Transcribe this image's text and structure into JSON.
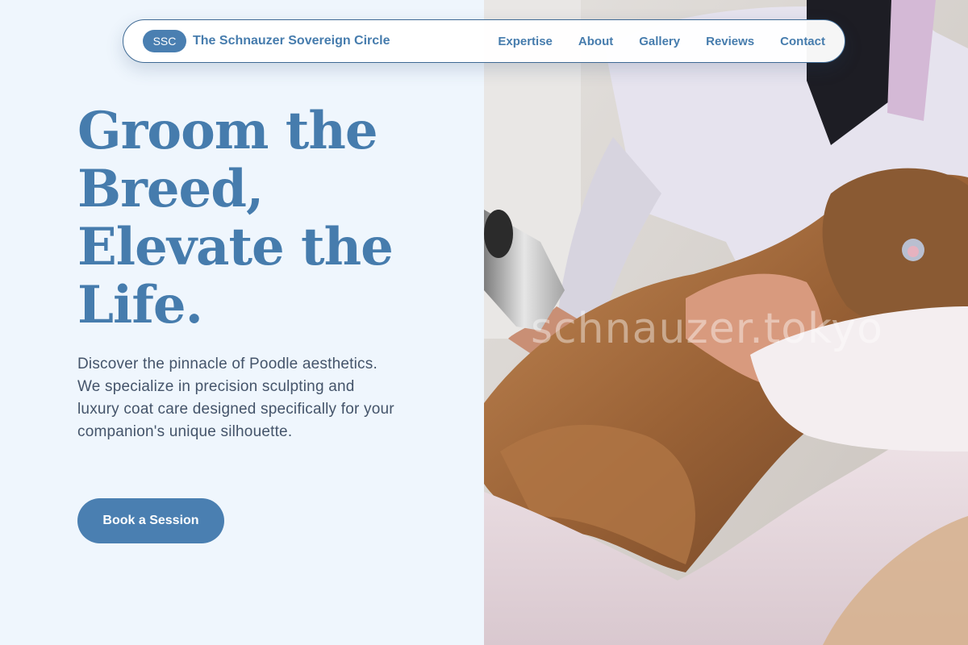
{
  "nav": {
    "logo_badge": "SSC",
    "brand_name": "The Schnauzer Sovereign Circle",
    "links": [
      "Expertise",
      "About",
      "Gallery",
      "Reviews",
      "Contact"
    ]
  },
  "hero": {
    "title_lines": [
      "Groom the",
      "Breed,",
      "Elevate the",
      "Life."
    ],
    "body": "Discover the pinnacle of Poodle aesthetics. We specialize in precision sculpting and luxury coat care designed specifically for your companion's unique silhouette.",
    "cta_label": "Book a Session"
  },
  "photo": {
    "watermark": "schnauzer.tokyo",
    "subject": "groomer drying a wet long-haired dog wrapped in a towel"
  },
  "colors": {
    "accent": "#4a7fb1",
    "page_bg": "#eff6fd",
    "body_text": "#44546a"
  }
}
